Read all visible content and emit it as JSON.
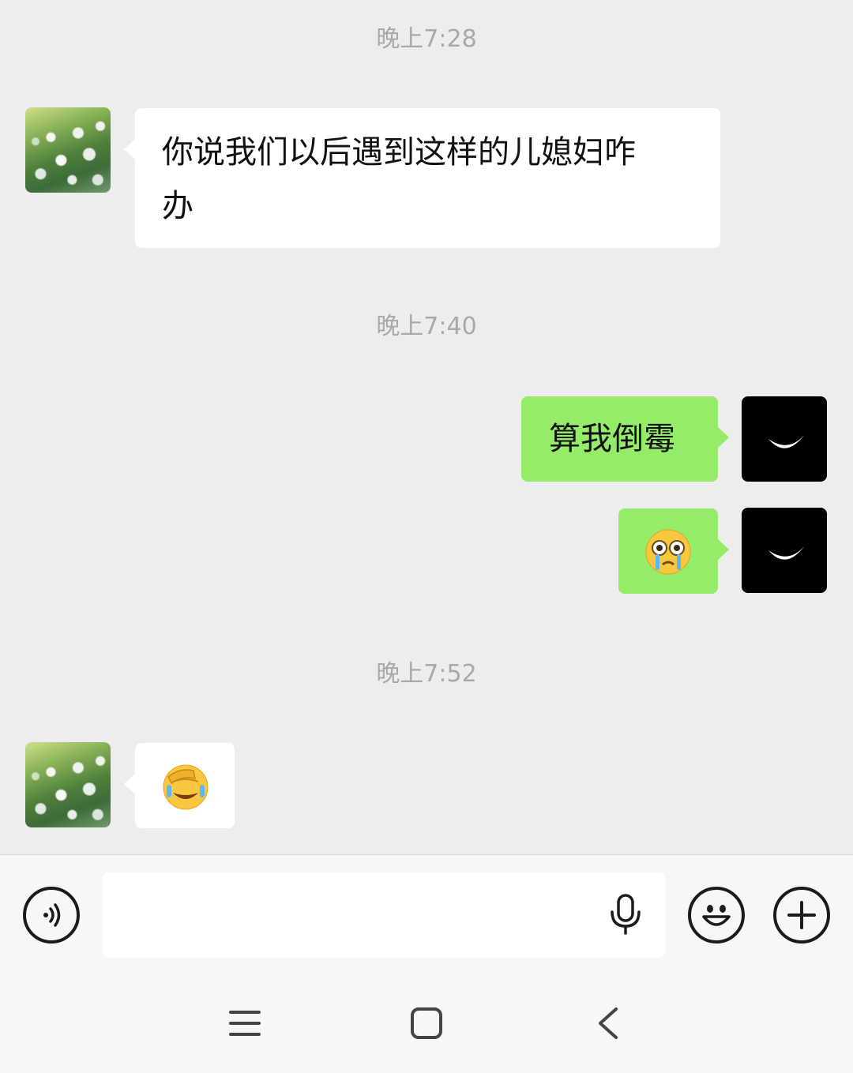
{
  "chat": {
    "timestamps": [
      "晚上7:28",
      "晚上7:40",
      "晚上7:52"
    ],
    "messages": [
      {
        "side": "left",
        "text": "你说我们以后遇到这样的儿媳妇咋办",
        "line1": "你说我们以后遇到这样的儿媳妇咋",
        "line2": "办"
      },
      {
        "side": "right",
        "text": "算我倒霉"
      },
      {
        "side": "right",
        "emoji": "crying-face-emoji"
      },
      {
        "side": "left",
        "emoji": "facepalm-laughing-emoji"
      }
    ]
  },
  "input_bar": {
    "voice_icon": "voice-mode-icon",
    "placeholder": "",
    "mic_icon": "microphone-icon",
    "emoji_icon": "smiley-icon",
    "more_icon": "plus-icon"
  },
  "nav": {
    "menu_icon": "menu-icon",
    "home_icon": "home-icon",
    "back_icon": "back-icon"
  },
  "colors": {
    "background": "#ededed",
    "bubble_self": "#95ec69",
    "bubble_other": "#ffffff",
    "timestamp": "#a9a9a9"
  }
}
